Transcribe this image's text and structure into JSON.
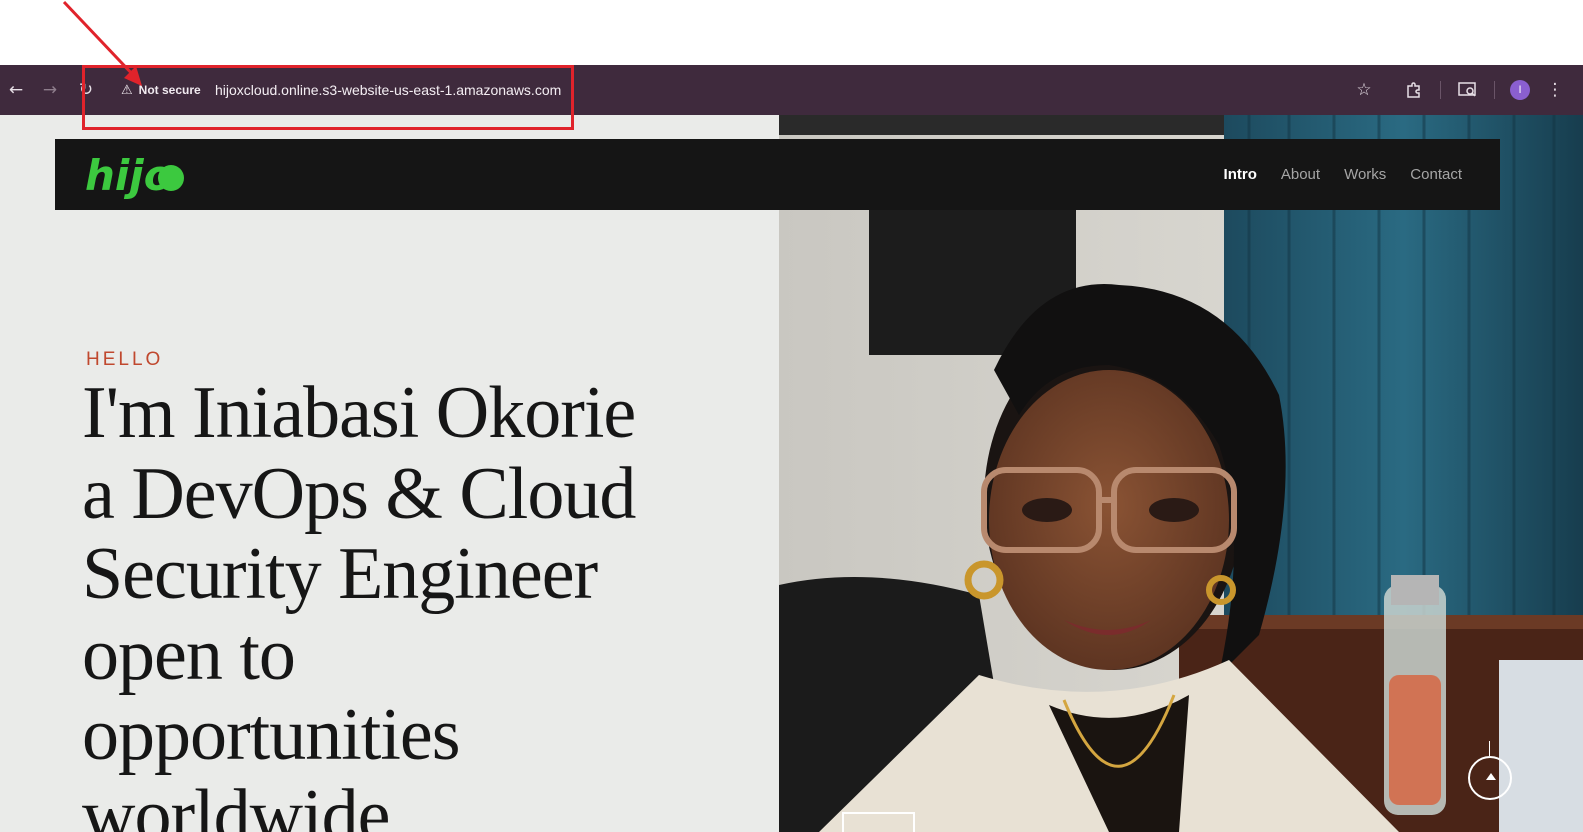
{
  "browser": {
    "security_label": "Not secure",
    "url": "hijoxcloud.online.s3-website-us-east-1.amazonaws.com",
    "profile_initial": "I",
    "icons": [
      "back-arrow-icon",
      "forward-arrow-icon",
      "reload-icon",
      "warning-icon",
      "star-icon",
      "extension-icon",
      "screen-search-icon",
      "menu-dots-icon"
    ],
    "toolbar_color": "#3f2a3d"
  },
  "annotation": {
    "color": "#e0232b"
  },
  "site": {
    "logo_text": "hijo",
    "logo_color": "#3cc93f",
    "nav": {
      "items": [
        "Intro",
        "About",
        "Works",
        "Contact"
      ],
      "active": "Intro"
    },
    "hero": {
      "kicker": "HELLO",
      "kicker_color": "#c0482e",
      "lines": [
        "I'm Iniabasi Okorie",
        "a DevOps & Cloud",
        "Security Engineer",
        "open to",
        "opportunities",
        "worldwide"
      ]
    }
  }
}
